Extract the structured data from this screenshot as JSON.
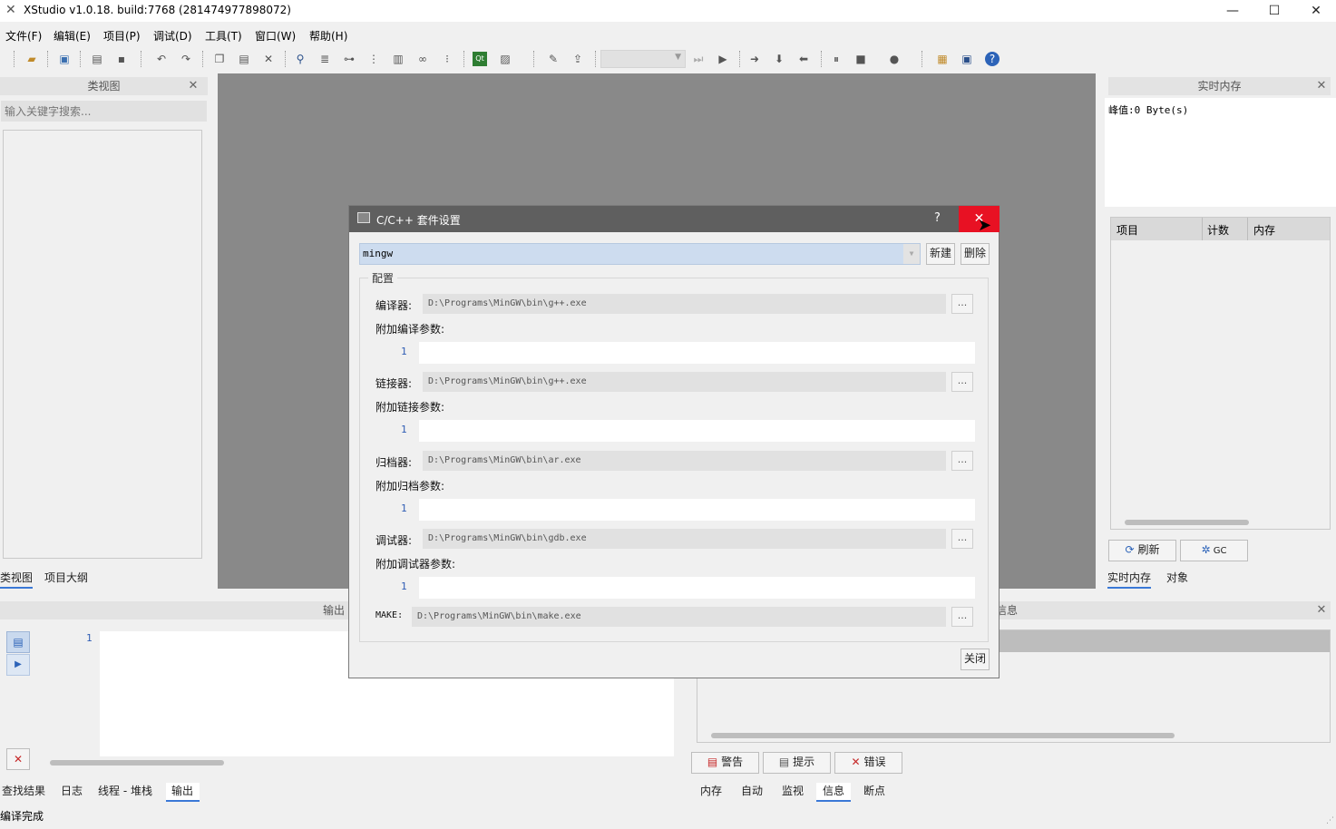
{
  "window": {
    "title": "XStudio v1.0.18. build:7768 (281474977898072)",
    "minimize": "—",
    "maximize": "☐",
    "close": "✕"
  },
  "menu": [
    "文件(F)",
    "编辑(E)",
    "项目(P)",
    "调试(D)",
    "工具(T)",
    "窗口(W)",
    "帮助(H)"
  ],
  "left_panel": {
    "title": "类视图",
    "search_placeholder": "输入关键字搜索...",
    "tabs": [
      "类视图",
      "项目大纲"
    ]
  },
  "right_panel": {
    "title": "实时内存",
    "peak": "峰值:0 Byte(s)",
    "columns": [
      "项目",
      "计数",
      "内存"
    ],
    "refresh": "刷新",
    "gc": "GC",
    "tabs": [
      "实时内存",
      "对象"
    ]
  },
  "output_panel": {
    "title": "输出",
    "line": "1",
    "tabs": [
      "查找结果",
      "日志",
      "线程 - 堆栈",
      "输出"
    ]
  },
  "info_panel": {
    "title": "信息",
    "buttons": [
      "警告",
      "提示",
      "错误"
    ],
    "tabs": [
      "内存",
      "自动",
      "监视",
      "信息",
      "断点"
    ]
  },
  "status": "编译完成",
  "dialog": {
    "title": "C/C++ 套件设置",
    "help": "?",
    "close": "✕",
    "kit": "mingw",
    "new_label": "新建",
    "delete_label": "删除",
    "group_label": "配置",
    "compiler_label": "编译器:",
    "compiler_path": "D:\\Programs\\MinGW\\bin\\g++.exe",
    "compile_args_label": "附加编译参数:",
    "linker_label": "链接器:",
    "linker_path": "D:\\Programs\\MinGW\\bin\\g++.exe",
    "link_args_label": "附加链接参数:",
    "archiver_label": "归档器:",
    "archiver_path": "D:\\Programs\\MinGW\\bin\\ar.exe",
    "archive_args_label": "附加归档参数:",
    "debugger_label": "调试器:",
    "debugger_path": "D:\\Programs\\MinGW\\bin\\gdb.exe",
    "debug_args_label": "附加调试器参数:",
    "make_label": "MAKE:",
    "make_path": "D:\\Programs\\MinGW\\bin\\make.exe",
    "line_no": "1",
    "browse": "...",
    "close_label": "关闭"
  }
}
